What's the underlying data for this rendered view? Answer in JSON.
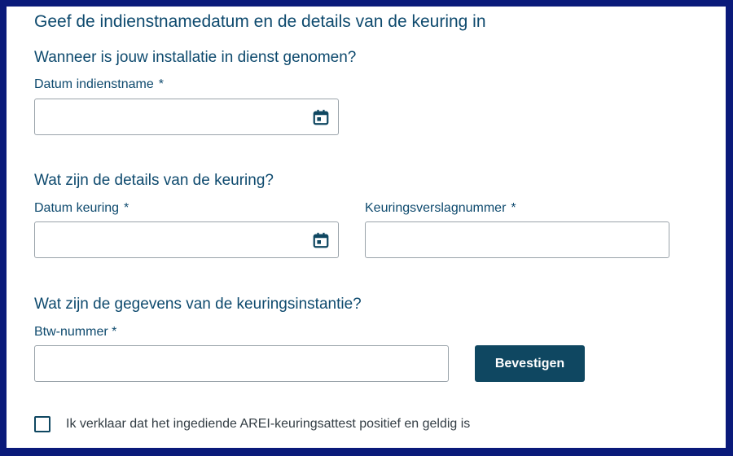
{
  "page": {
    "title": "Geef de indienstnamedatum en de details van de keuring in"
  },
  "section_installation": {
    "title": "Wanneer is jouw installatie in dienst genomen?",
    "date_label": "Datum indienstname",
    "date_required": "*",
    "date_value": "",
    "date_icon": "calendar-icon"
  },
  "section_inspection": {
    "title": "Wat zijn de details van de keuring?",
    "date_label": "Datum keuring",
    "date_required": "*",
    "date_value": "",
    "date_icon": "calendar-icon",
    "report_label": "Keuringsverslagnummer",
    "report_required": "*",
    "report_value": ""
  },
  "section_agency": {
    "title": "Wat zijn de gegevens van de keuringsinstantie?",
    "vat_label": "Btw-nummer *",
    "vat_value": "",
    "confirm_label": "Bevestigen"
  },
  "declaration": {
    "checked": false,
    "label": "Ik verklaar dat het ingediende AREI-keuringsattest positief en geldig is"
  },
  "colors": {
    "frame": "#0a1a7a",
    "heading": "#0e4a6e",
    "button": "#0f4761",
    "border": "#9aa3aa"
  }
}
